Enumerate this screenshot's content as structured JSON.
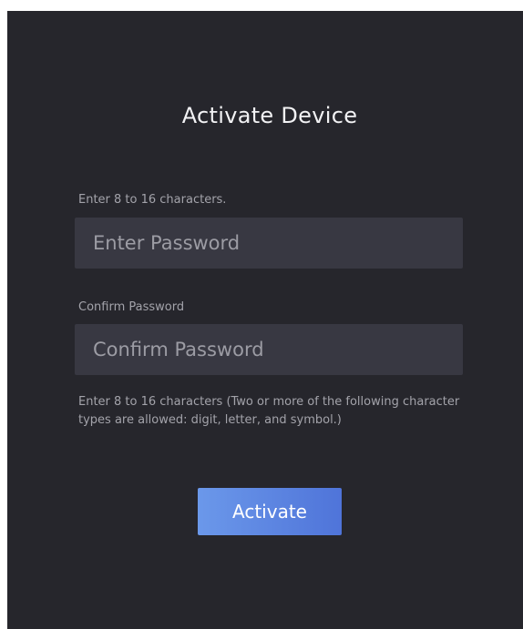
{
  "title": "Activate Device",
  "password": {
    "label": "Enter 8 to 16 characters.",
    "placeholder": "Enter Password",
    "value": ""
  },
  "confirm": {
    "label": "Confirm Password",
    "placeholder": "Confirm Password",
    "value": ""
  },
  "hint": "Enter 8 to 16 characters (Two or more of the following character types are allowed: digit, letter, and symbol.)",
  "activate_label": "Activate",
  "colors": {
    "background": "#26262c",
    "input_bg": "#383842",
    "button_start": "#6b98ea",
    "button_end": "#4f74d9"
  }
}
